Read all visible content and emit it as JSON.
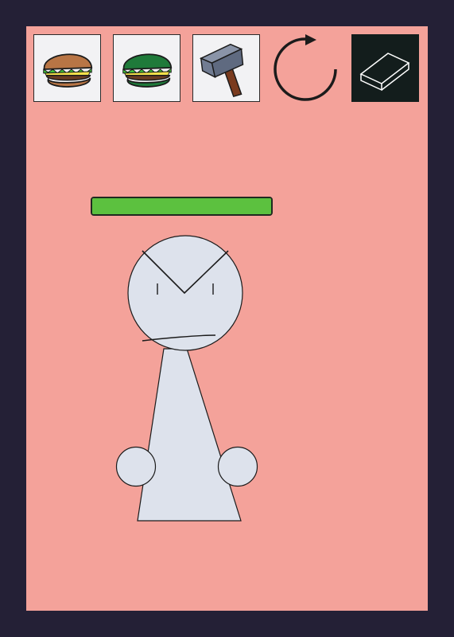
{
  "toolbar": {
    "tools": [
      {
        "id": "burger",
        "icon": "burger-icon"
      },
      {
        "id": "green-burger",
        "icon": "green-burger-icon"
      },
      {
        "id": "hammer",
        "icon": "hammer-icon"
      },
      {
        "id": "reset",
        "icon": "reset-arrow-icon"
      },
      {
        "id": "eraser",
        "icon": "eraser-icon",
        "selected": true
      }
    ]
  },
  "character": {
    "health_fraction": 1.0,
    "health_color": "#5cc13f",
    "body_color": "#dde2ec",
    "mood": "angry"
  },
  "colors": {
    "background": "#f4a29a",
    "frame": "#242036",
    "selected_tool_bg": "#131d1c"
  }
}
